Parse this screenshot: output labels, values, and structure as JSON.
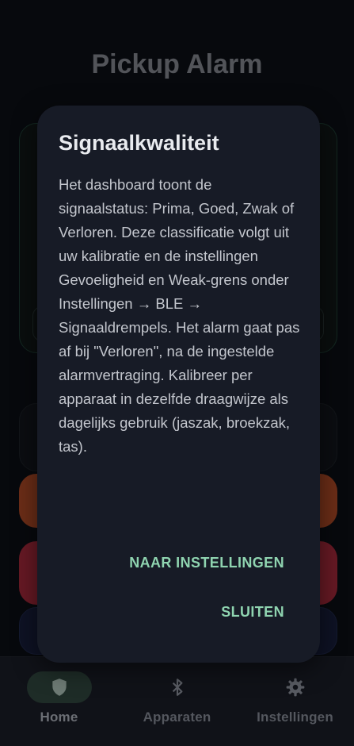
{
  "app": {
    "title": "Pickup Alarm"
  },
  "dialog": {
    "title": "Signaalkwaliteit",
    "body": "Het dashboard toont de signaalstatus: Prima, Goed, Zwak of Verloren. Deze classificatie volgt uit uw kalibratie en de instellingen Gevoeligheid en Weak-grens onder Instellingen → BLE → Signaaldrempels. Het alarm gaat pas af bij \"Verloren\", na de ingestelde alarmvertraging. Kalibreer per apparaat in dezelfde draagwijze als dagelijks gebruik (jaszak, broekzak, tas).",
    "action_settings": "NAAR INSTELLINGEN",
    "action_close": "SLUITEN"
  },
  "nav": {
    "items": [
      {
        "label": "Home",
        "icon": "shield-icon",
        "active": true
      },
      {
        "label": "Apparaten",
        "icon": "bluetooth-icon",
        "active": false
      },
      {
        "label": "Instellingen",
        "icon": "gear-icon",
        "active": false
      }
    ]
  },
  "colors": {
    "accent": "#8fd4b0",
    "dialog_bg": "#171b26",
    "alert_orange": "#a3421f",
    "alert_red": "#9b2433"
  }
}
